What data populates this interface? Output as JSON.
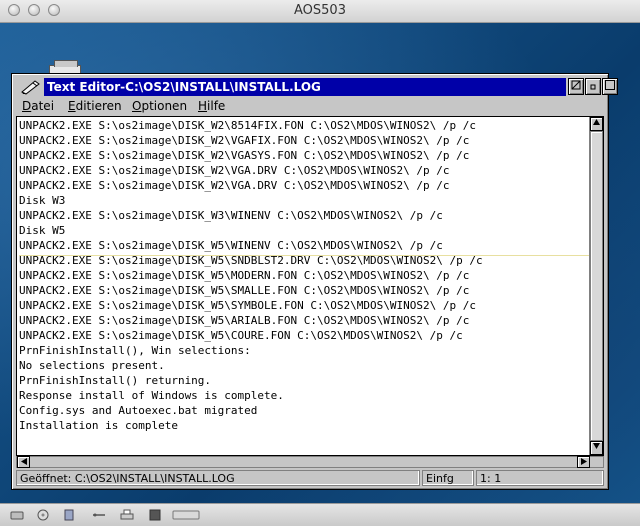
{
  "mac_window": {
    "title": "AOS503"
  },
  "editor": {
    "title": "Text Editor-C:\\OS2\\INSTALL\\INSTALL.LOG",
    "menu": [
      "Datei",
      "Editieren",
      "Optionen",
      "Hilfe"
    ],
    "lines": [
      "UNPACK2.EXE S:\\os2image\\DISK_W2\\8514FIX.FON C:\\OS2\\MDOS\\WINOS2\\ /p /c",
      "UNPACK2.EXE S:\\os2image\\DISK_W2\\VGAFIX.FON C:\\OS2\\MDOS\\WINOS2\\ /p /c",
      "UNPACK2.EXE S:\\os2image\\DISK_W2\\VGASYS.FON C:\\OS2\\MDOS\\WINOS2\\ /p /c",
      "UNPACK2.EXE S:\\os2image\\DISK_W2\\VGA.DRV C:\\OS2\\MDOS\\WINOS2\\ /p /c",
      "UNPACK2.EXE S:\\os2image\\DISK_W2\\VGA.DRV C:\\OS2\\MDOS\\WINOS2\\ /p /c",
      "Disk W3",
      "UNPACK2.EXE S:\\os2image\\DISK_W3\\WINENV C:\\OS2\\MDOS\\WINOS2\\ /p /c",
      "Disk W5",
      "UNPACK2.EXE S:\\os2image\\DISK_W5\\WINENV C:\\OS2\\MDOS\\WINOS2\\ /p /c",
      "UNPACK2.EXE S:\\os2image\\DISK_W5\\SNDBLST2.DRV C:\\OS2\\MDOS\\WINOS2\\ /p /c",
      "UNPACK2.EXE S:\\os2image\\DISK_W5\\MODERN.FON C:\\OS2\\MDOS\\WINOS2\\ /p /c",
      "UNPACK2.EXE S:\\os2image\\DISK_W5\\SMALLE.FON C:\\OS2\\MDOS\\WINOS2\\ /p /c",
      "UNPACK2.EXE S:\\os2image\\DISK_W5\\SYMBOLE.FON C:\\OS2\\MDOS\\WINOS2\\ /p /c",
      "UNPACK2.EXE S:\\os2image\\DISK_W5\\ARIALB.FON C:\\OS2\\MDOS\\WINOS2\\ /p /c",
      "UNPACK2.EXE S:\\os2image\\DISK_W5\\COURE.FON C:\\OS2\\MDOS\\WINOS2\\ /p /c",
      "PrnFinishInstall(), Win selections:",
      "No selections present.",
      "PrnFinishInstall() returning.",
      "Response install of Windows is complete.",
      "Config.sys and Autoexec.bat migrated",
      "Installation is complete"
    ],
    "status": {
      "file": "Geöffnet: C:\\OS2\\INSTALL\\INSTALL.LOG",
      "mode": "Einfg",
      "position": "1: 1"
    }
  },
  "colors": {
    "titlebar": "#0000a8",
    "window": "#c6c6c6",
    "desktop": "#0b4f86"
  }
}
